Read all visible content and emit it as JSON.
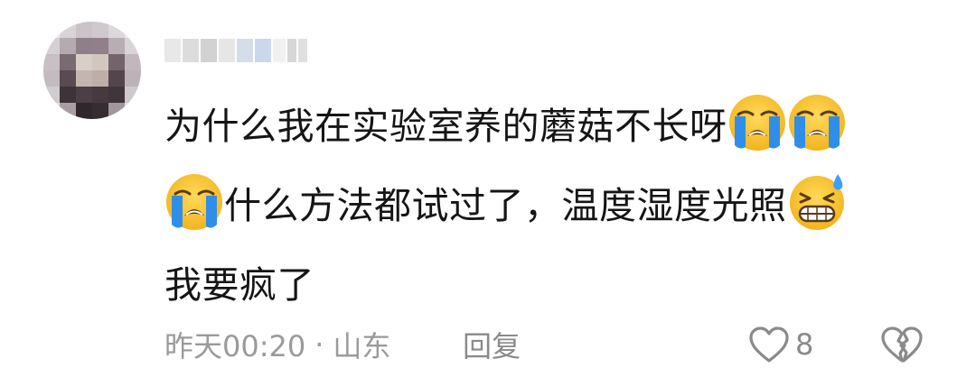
{
  "comment": {
    "lines": [
      {
        "text": "为什么我在实验室养的蘑菇不长呀",
        "emojis_after": [
          "loudly-crying-face",
          "loudly-crying-face"
        ]
      },
      {
        "emojis_before": [
          "loudly-crying-face"
        ],
        "text": "什么方法都试过了，温度湿度光照",
        "emojis_after": [
          "grinning-face-with-sweat"
        ]
      },
      {
        "text": "我要疯了"
      }
    ],
    "time": "昨天00:20",
    "separator": "·",
    "location": "山东",
    "reply_label": "回复",
    "like_count": "8"
  },
  "icons": {
    "like": "heart-outline-icon",
    "dislike": "broken-heart-outline-icon",
    "emoji_cry": "loudly-crying-face",
    "emoji_sweat": "grinning-face-with-sweat"
  },
  "colors": {
    "text": "#151515",
    "meta": "#9a9a9a",
    "emoji_yellow": "#f7c33c",
    "tear_blue": "#2f8fe8"
  }
}
